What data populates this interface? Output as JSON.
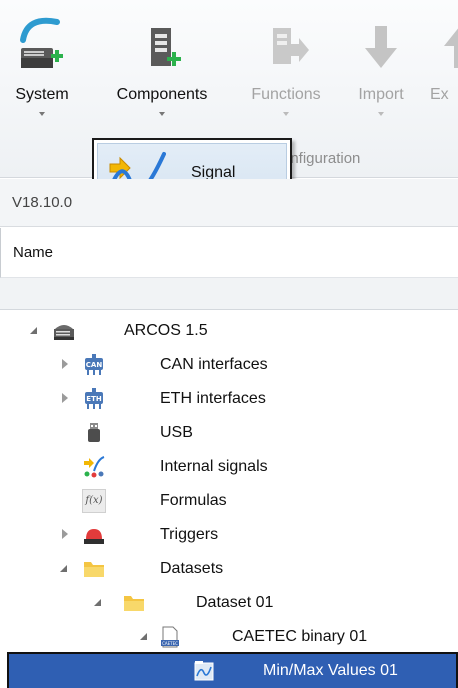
{
  "ribbon": {
    "buttons": [
      {
        "label": "System",
        "icon": "system-add-icon",
        "enabled": true
      },
      {
        "label": "Components",
        "icon": "components-add-icon",
        "enabled": true
      },
      {
        "label": "Functions",
        "icon": "functions-icon",
        "enabled": false
      },
      {
        "label": "Import",
        "icon": "import-arrow-icon",
        "enabled": false
      },
      {
        "label": "Ex",
        "icon": "export-icon",
        "enabled": false
      }
    ],
    "group_label": "onfiguration"
  },
  "popup": {
    "item_label": "Signal",
    "icon": "signal-icon"
  },
  "version": "V18.10.0",
  "header": {
    "column_name": "Name"
  },
  "tree": {
    "rows": [
      {
        "label": "ARCOS 1.5",
        "icon": "device-icon",
        "expander": "expanded"
      },
      {
        "label": "CAN interfaces",
        "icon": "can-interface-icon",
        "expander": "collapsed"
      },
      {
        "label": "ETH interfaces",
        "icon": "eth-interface-icon",
        "expander": "collapsed"
      },
      {
        "label": "USB",
        "icon": "usb-icon",
        "expander": "none"
      },
      {
        "label": "Internal signals",
        "icon": "internal-signals-icon",
        "expander": "none"
      },
      {
        "label": "Formulas",
        "icon": "formula-icon",
        "icon_text": "f(x)",
        "expander": "none"
      },
      {
        "label": "Triggers",
        "icon": "trigger-icon",
        "expander": "collapsed"
      },
      {
        "label": "Datasets",
        "icon": "folder-icon",
        "expander": "expanded"
      },
      {
        "label": "Dataset 01",
        "icon": "folder-icon",
        "expander": "expanded"
      },
      {
        "label": "CAETEC binary 01",
        "icon": "binary-file-icon",
        "icon_text": "CAETEC",
        "expander": "expanded"
      },
      {
        "label": "Min/Max Values 01",
        "icon": "minmax-values-icon",
        "expander": "none",
        "selected": true
      }
    ]
  },
  "colors": {
    "selection": "#2f5fb3",
    "folder": "#f4c542",
    "device_blue": "#4a78b8",
    "disabled_text": "#a3a3a3"
  }
}
